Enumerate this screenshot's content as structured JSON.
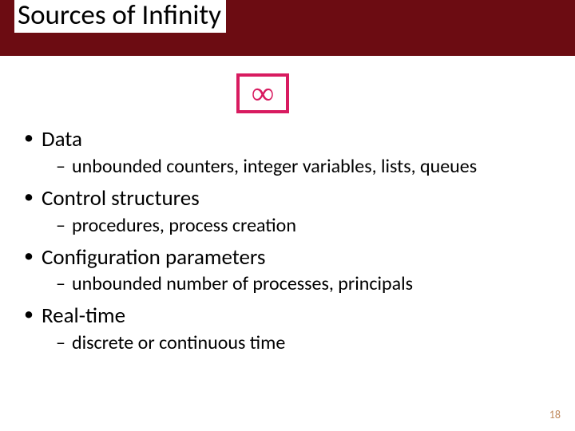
{
  "title": "Sources of Infinity",
  "infinity_symbol": "∞",
  "bullets": {
    "b1_0": "Data",
    "b2_0": "unbounded counters, integer variables, lists, queues",
    "b1_1": "Control structures",
    "b2_1": "procedures, process creation",
    "b1_2": "Configuration parameters",
    "b2_2": "unbounded number of processes, principals",
    "b1_3": "Real-time",
    "b2_3": "discrete or continuous time"
  },
  "page_number": "18"
}
